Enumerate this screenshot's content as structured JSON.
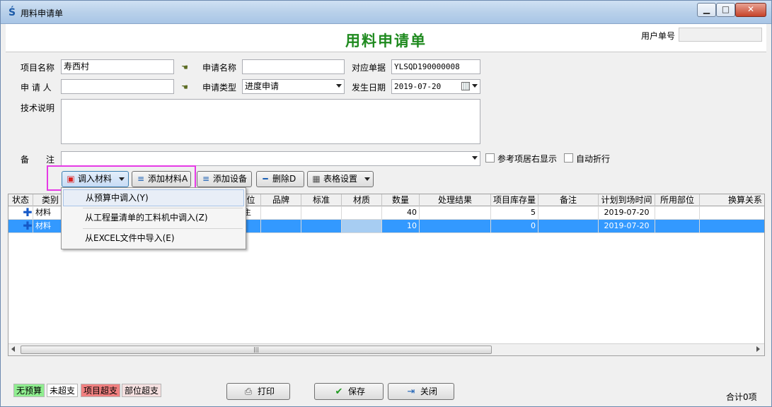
{
  "window": {
    "title": "用料申请单",
    "min_glyph": "▁",
    "max_glyph": "□",
    "close_glyph": "✕"
  },
  "header": {
    "form_title": "用料申请单",
    "user_no_label": "用户单号",
    "user_no_value": ""
  },
  "form": {
    "project_name_label": "项目名称",
    "project_name_value": "寿西村",
    "user_name_label": "申请名称",
    "user_name_value": "",
    "ref_doc_label": "对应单据",
    "ref_doc_value": "YLSQD190000008",
    "applicant_label": "申 请 人",
    "applicant_value": "",
    "apply_type_label": "申请类型",
    "apply_type_value": "进度申请",
    "date_label": "发生日期",
    "date_value": "2019-07-20",
    "tech_desc_label": "技术说明",
    "tech_desc_value": "",
    "remark_label": "备　　注",
    "remark_value": "",
    "ref_right_label": "参考项居右显示",
    "auto_wrap_label": "自动折行"
  },
  "toolbar": {
    "import_material": "调入材料",
    "add_material": "添加材料A",
    "add_equipment": "添加设备",
    "delete": "删除D",
    "table_settings": "表格设置"
  },
  "grid": {
    "columns": [
      "状态",
      "类别",
      "",
      "位",
      "品牌",
      "标准",
      "材质",
      "数量",
      "处理结果",
      "项目库存量",
      "备注",
      "计划到场时间",
      "所用部位",
      "换算关系"
    ],
    "rows": [
      {
        "category": "材料",
        "unit": "主",
        "qty": "40",
        "stock": "5",
        "plan_date": "2019-07-20",
        "selected": false
      },
      {
        "category": "材料",
        "unit": "",
        "qty": "10",
        "stock": "0",
        "plan_date": "2019-07-20",
        "selected": true
      }
    ],
    "scroll_grip": "|||"
  },
  "menu": {
    "items": [
      "从预算中调入(Y)",
      "从工程量清单的工料机中调入(Z)",
      "从EXCEL文件中导入(E)"
    ]
  },
  "legend": {
    "no_budget": "无预算",
    "not_over": "未超支",
    "project_over": "项目超支",
    "part_over": "部位超支"
  },
  "buttons": {
    "print": "打印",
    "save": "保存",
    "close": "关闭"
  },
  "footer": {
    "total": "合计0项"
  },
  "colors": {
    "title_green": "#1f8a1f",
    "selection_blue": "#3399ff",
    "highlight_magenta": "#e63ae6",
    "legend_no_budget": "#90ee90",
    "legend_project_over": "#f08080",
    "legend_part_over": "#f5e0e0"
  }
}
